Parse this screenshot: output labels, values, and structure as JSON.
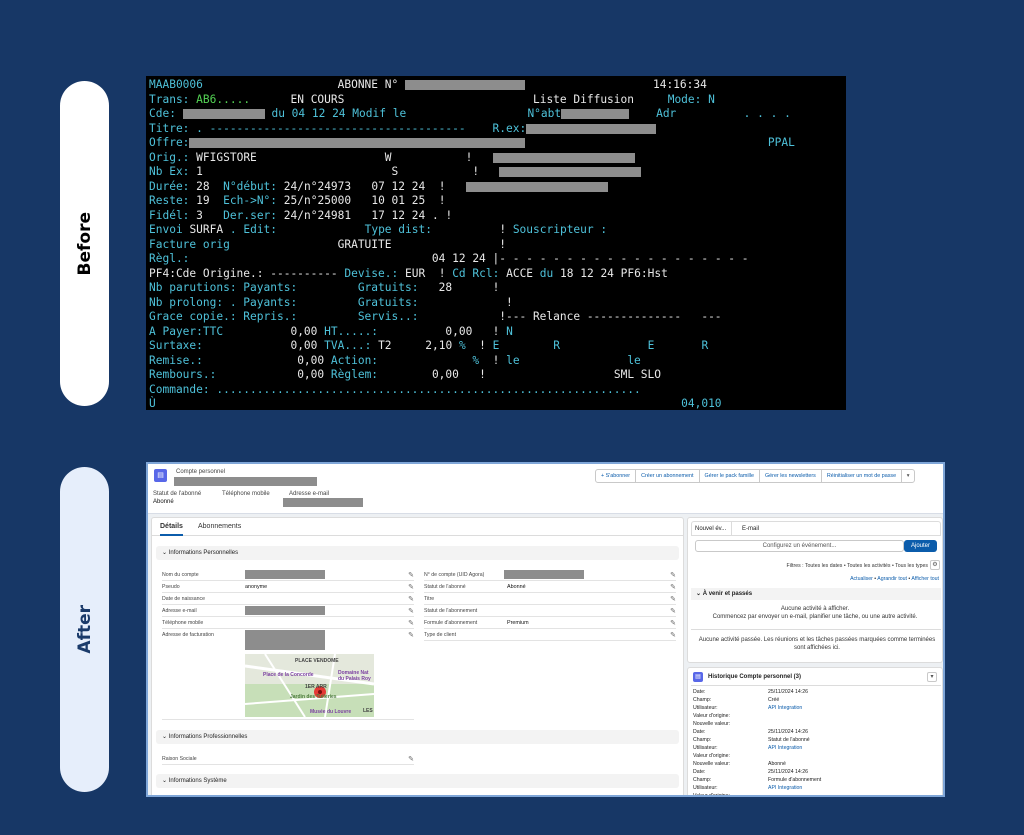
{
  "labels": {
    "before": "Before",
    "after": "After"
  },
  "terminal": {
    "code": "MAAB0006",
    "abonne": "ABONNE N°",
    "time": "14:16:34",
    "trans_label": "Trans:",
    "trans_value": "AB6.....",
    "status": "EN COURS",
    "liste": "Liste Diffusion",
    "mode": "Mode: N",
    "cde": "Cde:",
    "du": "du 04 12 24",
    "modif": "Modif le",
    "nabt": "N°abt",
    "adr": "Adr",
    "dots_small": ". . . .",
    "titre": "Titre: . --------------------------------------",
    "rex": "R.ex:",
    "offre": "Offre:",
    "ppal": "PPAL",
    "orig_label": "Orig.:",
    "orig_value": "WFIGSTORE",
    "w": "W",
    "s": "S",
    "excl": "!",
    "nbex_label": "Nb Ex:",
    "nbex_value": "1",
    "duree_label": "Durée:",
    "duree_value": "28",
    "ndebut_label": "N°début:",
    "ndebut_value": "24/n°24973   07 12 24",
    "reste_label": "Reste:",
    "reste_value": "19",
    "echn_label": "Ech->N°:",
    "echn_value": "25/n°25000   10 01 25",
    "fidel_label": "Fidél:",
    "fidel_value": "3",
    "derser_label": "Der.ser:",
    "derser_value": "24/n°24981   17 12 24 .",
    "envoi_label": "Envoi",
    "envoi_value": "SURFA",
    "edit": ". Edit:",
    "typedist": "Type dist:",
    "souscripteur": "Souscripteur :",
    "facture": "Facture orig",
    "gratuite": "GRATUITE",
    "regl_label": "Règl.:",
    "regl_value": "04 12 24",
    "dashes_right": "|- - - - - - - - - - - - - - - - - - -",
    "pf4": "PF4:Cde Origine.: ----------",
    "devise_label": "Devise.:",
    "devise_value": "EUR",
    "cdrcl_label": "Cd Rcl:",
    "cdrcl_value": "ACCE",
    "cdrcl_du": "du",
    "cdrcl_date": "18 12 24",
    "pf6": "PF6:Hst",
    "nbparutions": "Nb parutions: Payants:",
    "gratuits1_label": "Gratuits:",
    "gratuits1_value": "28",
    "nbprolong": "Nb prolong: . Payants:",
    "gratuits2_label": "Gratuits:",
    "grace": "Grace copie.: Repris.:",
    "servis": "Servis..:",
    "relance": "!--- Relance --------------   ---",
    "apayer": "A Payer:TTC",
    "apayer_value": "0,00",
    "ht_label": "HT.....:",
    "ht_value": "0,00",
    "n": "N",
    "surtaxe": "Surtaxe:",
    "surtaxe_value": "0,00",
    "tva_label": "TVA...:",
    "tva_code": "T2",
    "tva_value": "2,10",
    "pct": "%",
    "eree": "E        R             E       R",
    "remise": "Remise.:",
    "remise_value": "0,00",
    "action": "Action:",
    "lele": "le                le",
    "rembours": "Rembours.:",
    "rembours_value": "0,00",
    "reglem": "Règlem:",
    "reglem_value": "0,00",
    "sml": "SML SLO",
    "commande": "Commande: ...............................................................",
    "u": "Ù",
    "foot": "04,010"
  },
  "crm": {
    "record_type": "Compte personnel",
    "buttons": [
      "+ S'abonner",
      "Créer un abonnement",
      "Gérer le pack famille",
      "Gérer les newsletters",
      "Réinitialiser un mot de passe",
      "▾"
    ],
    "highlights": [
      {
        "label": "Statut de l'abonné",
        "value": "Abonné"
      },
      {
        "label": "Téléphone mobile",
        "value": ""
      },
      {
        "label": "Adresse e-mail",
        "value": ""
      }
    ],
    "tabs": [
      "Détails",
      "Abonnements"
    ],
    "sections": {
      "perso": "Informations Personnelles",
      "pro": "Informations Professionnelles",
      "sys": "Informations Système"
    },
    "left_fields": [
      {
        "label": "Nom du compte",
        "value": ""
      },
      {
        "label": "Pseudo",
        "value": "anonyme"
      },
      {
        "label": "Date de naissance",
        "value": ""
      },
      {
        "label": "Adresse e-mail",
        "value": ""
      },
      {
        "label": "Téléphone mobile",
        "value": ""
      },
      {
        "label": "Adresse de facturation",
        "value": ""
      }
    ],
    "right_fields": [
      {
        "label": "N° de compte (UID Agora)",
        "value": ""
      },
      {
        "label": "Statut de l'abonné",
        "value": "Abonné"
      },
      {
        "label": "Titre",
        "value": ""
      },
      {
        "label": "Statut de l'abonnement",
        "value": ""
      },
      {
        "label": "Formule d'abonnement",
        "value": "Premium"
      },
      {
        "label": "Type de client",
        "value": ""
      }
    ],
    "map_labels": [
      "PLACE VENDOME",
      "Place de la Concorde",
      "Domaine Nat du Palais Roy",
      "1ER ARR",
      "Jardin des Tuileries",
      "Musée du Louvre",
      "LES"
    ],
    "raison_sociale": "Raison Sociale",
    "activity": {
      "tabs": [
        "Nouvel év...",
        "E-mail"
      ],
      "input_placeholder": "Configurez un événement...",
      "add_button": "Ajouter",
      "filters": "Filtres : Toutes les dates • Toutes les activités • Tous les types",
      "links": [
        "Actualiser",
        "Agrandir tout",
        "Afficher tout"
      ],
      "upcoming_title": "À venir et passés",
      "no_activity": "Aucune activité à afficher.",
      "start_hint": "Commencez par envoyer un e-mail, planifier une tâche, ou une autre activité.",
      "no_past": "Aucune activité passée. Les réunions et les tâches passées marquées comme terminées sont affichées ici."
    },
    "history": {
      "title": "Historique Compte personnel (3)",
      "labels": [
        "Date:",
        "Champ:",
        "Utilisateur:",
        "Valeur d'origine:",
        "Nouvelle valeur:"
      ],
      "entries": [
        {
          "date": "25/11/2024 14:26",
          "champ": "Créé",
          "user": "API Integration",
          "orig": "",
          "new": ""
        },
        {
          "date": "25/11/2024 14:26",
          "champ": "Statut de l'abonné",
          "user": "API Integration",
          "orig": "",
          "new": "Abonné"
        },
        {
          "date": "25/11/2024 14:26",
          "champ": "Formule d'abonnement",
          "user": "API Integration",
          "orig": "",
          "new": ""
        }
      ]
    }
  }
}
